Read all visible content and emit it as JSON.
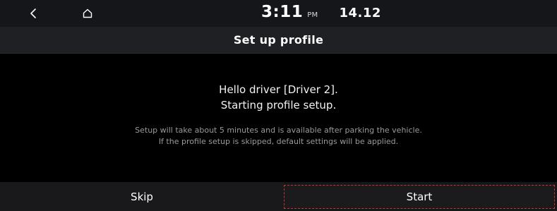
{
  "status_bar": {
    "back_icon": "chevron-left-icon",
    "home_icon": "home-icon",
    "time": "3:11",
    "ampm": "PM",
    "date": "14.12"
  },
  "header": {
    "title": "Set up profile"
  },
  "main": {
    "greeting_line1": "Hello driver [Driver 2].",
    "greeting_line2": "Starting profile setup.",
    "info_line1": "Setup will take about 5 minutes and is available after parking the vehicle.",
    "info_line2": "If the profile setup is skipped, default settings will be applied."
  },
  "buttons": {
    "skip_label": "Skip",
    "start_label": "Start"
  },
  "colors": {
    "background": "#000000",
    "bar": "#151619",
    "focus_outline": "#c0392b",
    "secondary_text": "#9a9a9e"
  }
}
